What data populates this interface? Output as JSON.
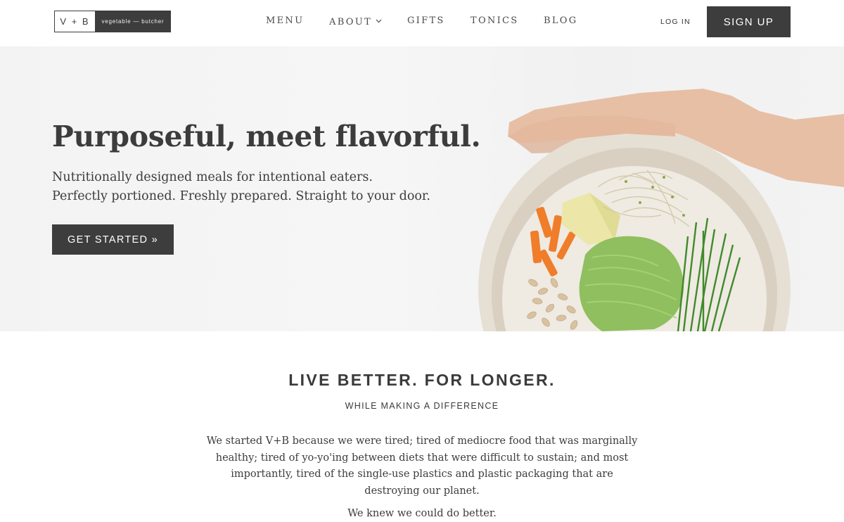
{
  "header": {
    "logo": {
      "mark": "V + B",
      "wordmark": "vegetable — butcher"
    },
    "nav": [
      {
        "label": "MENU"
      },
      {
        "label": "ABOUT",
        "has_dropdown": true
      },
      {
        "label": "GIFTS"
      },
      {
        "label": "TONICS"
      },
      {
        "label": "BLOG"
      }
    ],
    "login_label": "LOG IN",
    "signup_label": "SIGN UP"
  },
  "hero": {
    "title": "Purposeful, meet flavorful.",
    "subtitle_lines": [
      "Nutritionally designed meals for intentional eaters.",
      "Perfectly portioned. Freshly prepared. Straight to your door."
    ],
    "cta_label": "GET STARTED »",
    "image": "hand holding a bowl of avocado, carrots, sprouts, chives and sunflower seeds"
  },
  "intro": {
    "heading": "LIVE BETTER. FOR LONGER.",
    "subheading": "WHILE MAKING A DIFFERENCE",
    "body": "We started V+B because we were tired; tired of mediocre food that was marginally healthy; tired of yo-yo'ing between diets that were difficult to sustain; and most importantly, tired of the single-use plastics and plastic packaging that are destroying our planet.",
    "closing": "We knew we could do better."
  },
  "colors": {
    "dark": "#3d3d3d",
    "text": "#3c3c3c",
    "hero_bg": "#f4f4f4",
    "white": "#ffffff"
  }
}
